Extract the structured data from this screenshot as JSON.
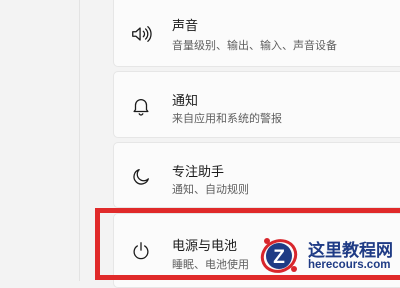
{
  "settings": {
    "items": [
      {
        "title": "声音",
        "subtitle": "音量级别、输出、输入、声音设备",
        "icon": "speaker-icon"
      },
      {
        "title": "通知",
        "subtitle": "来自应用和系统的警报",
        "icon": "bell-icon"
      },
      {
        "title": "专注助手",
        "subtitle": "通知、自动规则",
        "icon": "moon-icon"
      },
      {
        "title": "电源与电池",
        "subtitle": "睡眠、电池使用",
        "icon": "power-icon"
      }
    ]
  },
  "watermark": {
    "title": "这里教程网",
    "url": "herecours.com",
    "logo_letter": "Z"
  },
  "colors": {
    "highlight": "#e02a2a",
    "watermark_blue": "#1f3b85",
    "watermark_red": "#d8262c"
  }
}
